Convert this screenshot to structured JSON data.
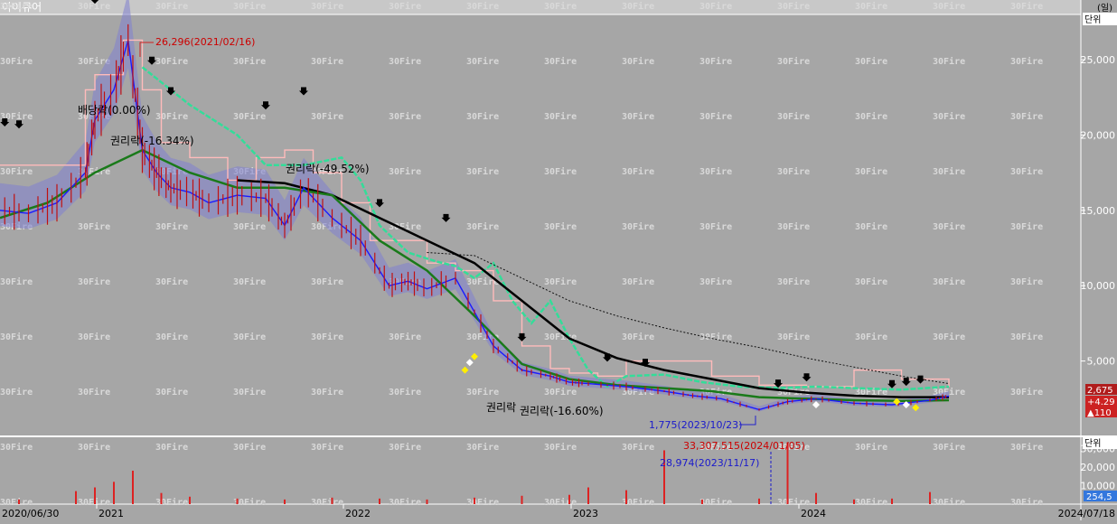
{
  "stock_name": "아이큐어",
  "watermark": "30Fire",
  "unit_label": "단위",
  "unit_label_alt": "(일)",
  "current_price": "2,675",
  "change_pct": "+4.29",
  "change_abs": "▲110",
  "volume_current": "254,5",
  "annotations": {
    "price_high": "26,296(2021/02/16)",
    "price_low": "1,775(2023/10/23)",
    "dividend": "배당락(0.00%)",
    "rights1": "권리락(-16.34%)",
    "rights2": "권리락(-49.52%)",
    "rights3": "권리락",
    "rights4": "권리락(-16.60%)",
    "vol_high": "33,307,515(2024/01/05)",
    "vol_mark": "28,974(2023/11/17)"
  },
  "chart_data": {
    "type": "line",
    "x_labels": [
      "2020/06/30",
      "2021",
      "2022",
      "2023",
      "2024",
      "2024/07/18"
    ],
    "price_axis": {
      "ticks": [
        5000,
        10000,
        15000,
        20000,
        25000
      ],
      "tick_labels": [
        "5,000",
        "10,000",
        "15,000",
        "20,000",
        "25,000"
      ],
      "ylim": [
        0,
        28000
      ]
    },
    "volume_axis": {
      "ticks": [
        10000,
        20000,
        30000
      ],
      "tick_labels": [
        "10,000",
        "20,000",
        "30,000"
      ],
      "ylim": [
        0,
        36000
      ]
    },
    "series": [
      {
        "key": "price",
        "color": "#1a1aff",
        "x": [
          0,
          0.03,
          0.06,
          0.09,
          0.1,
          0.12,
          0.135,
          0.15,
          0.165,
          0.18,
          0.2,
          0.22,
          0.25,
          0.28,
          0.3,
          0.32,
          0.35,
          0.38,
          0.41,
          0.43,
          0.45,
          0.48,
          0.52,
          0.55,
          0.58,
          0.6,
          0.62,
          0.66,
          0.7,
          0.73,
          0.76,
          0.8,
          0.83,
          0.86,
          0.9,
          0.94,
          0.98,
          1.0
        ],
        "y": [
          15000,
          14800,
          15500,
          17500,
          21000,
          23000,
          26296,
          19000,
          17500,
          16500,
          16200,
          15500,
          16000,
          15800,
          14000,
          16500,
          14500,
          13000,
          10000,
          10300,
          9800,
          10500,
          6000,
          4400,
          4000,
          3600,
          3500,
          3300,
          3000,
          2700,
          2500,
          1775,
          2300,
          2500,
          2200,
          2100,
          2400,
          2675
        ]
      },
      {
        "key": "ma_green",
        "color": "#1a7a1a",
        "x": [
          0,
          0.05,
          0.1,
          0.15,
          0.2,
          0.25,
          0.3,
          0.35,
          0.4,
          0.45,
          0.5,
          0.55,
          0.6,
          0.65,
          0.7,
          0.75,
          0.8,
          0.85,
          0.9,
          0.95,
          1.0
        ],
        "y": [
          14500,
          15500,
          17500,
          19000,
          17500,
          16500,
          16500,
          16000,
          13000,
          11000,
          8000,
          4800,
          3800,
          3400,
          3200,
          3000,
          2600,
          2500,
          2400,
          2350,
          2400
        ]
      },
      {
        "key": "ma_black",
        "color": "#000000",
        "x": [
          0.25,
          0.3,
          0.35,
          0.4,
          0.45,
          0.5,
          0.55,
          0.6,
          0.65,
          0.7,
          0.75,
          0.8,
          0.85,
          0.9,
          0.95,
          1.0
        ],
        "y": [
          17000,
          16800,
          16000,
          14500,
          13000,
          11500,
          9000,
          6500,
          5200,
          4400,
          3800,
          3200,
          2900,
          2700,
          2600,
          2600
        ]
      },
      {
        "key": "ma_dotted",
        "color": "#111111",
        "x": [
          0.45,
          0.5,
          0.55,
          0.6,
          0.65,
          0.7,
          0.75,
          0.8,
          0.85,
          0.9,
          0.95,
          1.0
        ],
        "y": [
          12200,
          12000,
          10500,
          9000,
          8000,
          7200,
          6500,
          5900,
          5200,
          4600,
          4000,
          3500
        ]
      },
      {
        "key": "envelope_cyan",
        "color": "#33dd99",
        "x": [
          0.15,
          0.2,
          0.25,
          0.28,
          0.32,
          0.36,
          0.38,
          0.4,
          0.43,
          0.46,
          0.48,
          0.5,
          0.52,
          0.54,
          0.56,
          0.58,
          0.6,
          0.62,
          0.64,
          0.66,
          0.7,
          0.74,
          0.78,
          0.82,
          0.86,
          0.9,
          0.95,
          1.0
        ],
        "y": [
          24500,
          22000,
          20000,
          18000,
          18000,
          18500,
          17000,
          14000,
          12200,
          11600,
          11300,
          10500,
          11500,
          9000,
          7500,
          9000,
          6500,
          4400,
          3300,
          4000,
          4100,
          3600,
          3300,
          3200,
          3300,
          3200,
          3100,
          3300
        ]
      },
      {
        "key": "resistance_pink",
        "color": "#ffbbbb",
        "x": [
          0.0,
          0.05,
          0.09,
          0.1,
          0.13,
          0.15,
          0.17,
          0.2,
          0.24,
          0.27,
          0.3,
          0.33,
          0.36,
          0.39,
          0.42,
          0.45,
          0.48,
          0.52,
          0.55,
          0.58,
          0.6,
          0.63,
          0.66,
          0.7,
          0.75,
          0.8,
          0.85,
          0.9,
          0.95,
          1.0
        ],
        "y": [
          18000,
          18000,
          23000,
          24000,
          26296,
          23000,
          19500,
          18500,
          17000,
          18500,
          19000,
          17500,
          15500,
          13000,
          13000,
          11500,
          11000,
          9000,
          6000,
          4500,
          4200,
          4000,
          5000,
          5000,
          4000,
          3400,
          3300,
          4400,
          3800,
          3300
        ]
      }
    ],
    "volume": {
      "x": [
        0.02,
        0.08,
        0.1,
        0.12,
        0.14,
        0.17,
        0.2,
        0.25,
        0.3,
        0.35,
        0.4,
        0.45,
        0.5,
        0.55,
        0.6,
        0.62,
        0.66,
        0.7,
        0.74,
        0.8,
        0.83,
        0.86,
        0.9,
        0.94,
        0.98
      ],
      "values": [
        2500,
        7000,
        9000,
        12000,
        18000,
        6000,
        4000,
        3000,
        2500,
        3500,
        3000,
        2500,
        3500,
        4500,
        5000,
        9000,
        7500,
        28974,
        2500,
        3000,
        33307,
        6000,
        2500,
        3000,
        6500
      ]
    }
  }
}
